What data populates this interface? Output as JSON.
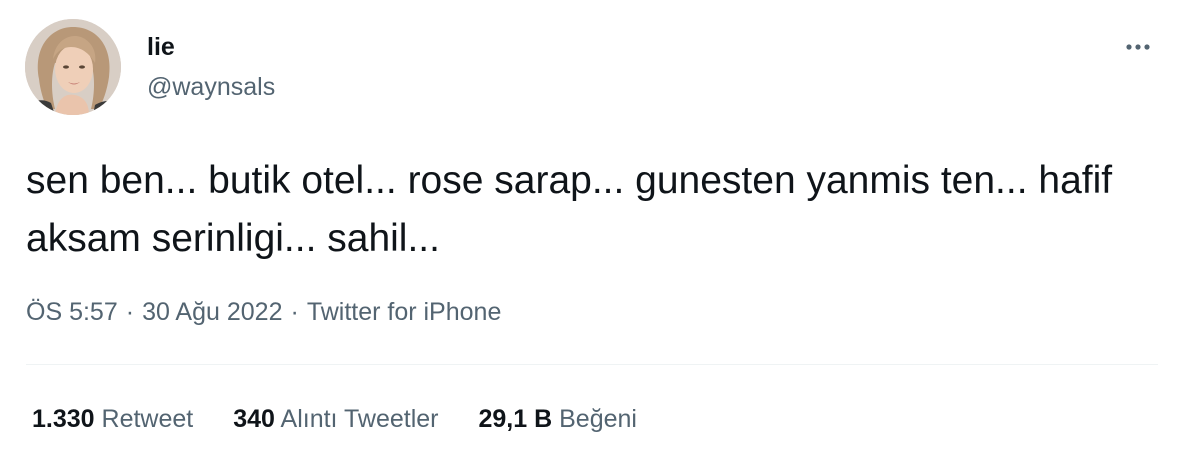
{
  "author": {
    "display_name": "lie",
    "handle": "@waynsals",
    "avatar_icon": "profile-photo"
  },
  "tweet": {
    "text": "sen ben... butik otel... rose sarap... gunesten yanmis ten... hafif aksam serinligi... sahil...",
    "time": "ÖS 5:57",
    "date": "30 Ağu 2022",
    "separator": "·",
    "source": "Twitter for iPhone"
  },
  "stats": {
    "retweets": {
      "count": "1.330",
      "label": "Retweet"
    },
    "quotes": {
      "count": "340",
      "label": "Alıntı Tweetler"
    },
    "likes": {
      "count": "29,1 B",
      "label": "Beğeni"
    }
  },
  "colors": {
    "text_primary": "#0f1419",
    "text_secondary": "#536471",
    "divider": "#eff3f4"
  },
  "icons": {
    "more": "more-horizontal-icon"
  }
}
